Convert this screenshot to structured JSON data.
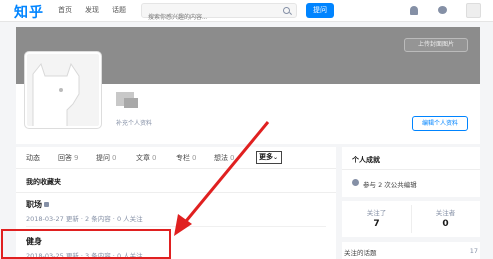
{
  "nav": {
    "logo": "知乎",
    "items": [
      "首页",
      "发现",
      "话题"
    ],
    "search_placeholder": "搜索你感兴趣的内容...",
    "ask_label": "提问"
  },
  "profile": {
    "cover_button": "上传封面图片",
    "fill_info": "补充个人资料",
    "edit_button": "编辑个人资料"
  },
  "tabs": [
    {
      "label": "动态",
      "count": ""
    },
    {
      "label": "回答",
      "count": "9"
    },
    {
      "label": "提问",
      "count": "0"
    },
    {
      "label": "文章",
      "count": "0"
    },
    {
      "label": "专栏",
      "count": "0"
    },
    {
      "label": "想法",
      "count": "0"
    },
    {
      "label": "更多",
      "count": ""
    }
  ],
  "collections": {
    "title": "我的收藏夹",
    "items": [
      {
        "name": "职场",
        "meta": "2018-03-27 更新 · 2 条内容 · 0 人关注",
        "locked": true
      },
      {
        "name": "健身",
        "meta": "2018-03-25 更新 · 3 条内容 · 0 人关注",
        "locked": false
      }
    ]
  },
  "sidebar": {
    "achievements_title": "个人成就",
    "edit_stat": "参与 2 次公共编辑",
    "following_label": "关注了",
    "following_count": "7",
    "followers_label": "关注者",
    "followers_count": "0",
    "topics_label": "关注的话题",
    "topics_count": "17"
  },
  "colors": {
    "accent": "#0084ff",
    "annotation": "#e02020"
  }
}
